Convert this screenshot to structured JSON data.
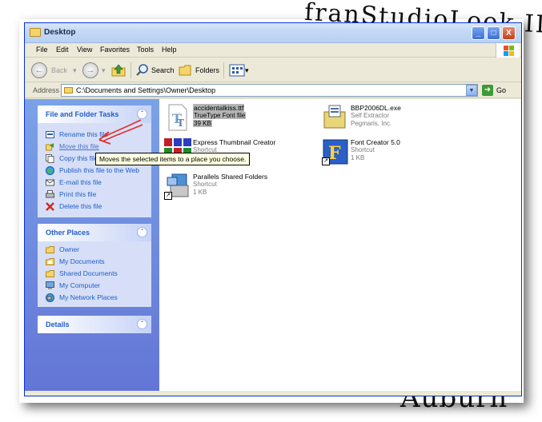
{
  "background": {
    "handwriting_top": "franStudioLook IL",
    "handwriting_bottom": "Auburn"
  },
  "window": {
    "title": "Desktop",
    "buttons": {
      "minimize": "_",
      "maximize": "□",
      "close": "X"
    }
  },
  "menu": {
    "items": [
      "File",
      "Edit",
      "View",
      "Favorites",
      "Tools",
      "Help"
    ]
  },
  "toolbar": {
    "back_label": "Back",
    "search_label": "Search",
    "folders_label": "Folders"
  },
  "address": {
    "label": "Address",
    "value": "C:\\Documents and Settings\\Owner\\Desktop",
    "go_label": "Go"
  },
  "tasks_panel": {
    "title": "File and Folder Tasks",
    "items": [
      {
        "label": "Rename this file",
        "icon": "rename-icon"
      },
      {
        "label": "Move this file",
        "icon": "move-icon"
      },
      {
        "label": "Copy this file",
        "icon": "copy-icon"
      },
      {
        "label": "Publish this file to the Web",
        "icon": "publish-icon"
      },
      {
        "label": "E-mail this file",
        "icon": "email-icon"
      },
      {
        "label": "Print this file",
        "icon": "print-icon"
      },
      {
        "label": "Delete this file",
        "icon": "delete-icon"
      }
    ]
  },
  "places_panel": {
    "title": "Other Places",
    "items": [
      {
        "label": "Owner",
        "icon": "folder-icon"
      },
      {
        "label": "My Documents",
        "icon": "my-documents-icon"
      },
      {
        "label": "Shared Documents",
        "icon": "folder-icon"
      },
      {
        "label": "My Computer",
        "icon": "my-computer-icon"
      },
      {
        "label": "My Network Places",
        "icon": "network-icon"
      }
    ]
  },
  "details_panel": {
    "title": "Details"
  },
  "tooltip": {
    "text": "Moves the selected items to a place you choose."
  },
  "files": [
    {
      "name": "accidentalkiss.ttf",
      "type": "TrueType Font file",
      "size": "39 KB",
      "icon": "font-file-icon",
      "selected": true
    },
    {
      "name": "BBP2006DL.exe",
      "type": "Self Extractor",
      "size": "Pegmaris, Inc.",
      "icon": "installer-icon"
    },
    {
      "name": "Express Thumbnail Creator",
      "type": "Shortcut",
      "size": "",
      "icon": "thumbnail-app-icon"
    },
    {
      "name": "Font Creator 5.0",
      "type": "Shortcut",
      "size": "1 KB",
      "icon": "font-creator-icon"
    },
    {
      "name": "Parallels Shared Folders",
      "type": "Shortcut",
      "size": "1 KB",
      "icon": "shared-folders-icon"
    }
  ],
  "colors": {
    "task_link": "#215dc6",
    "left_pane_top": "#7ba2e7",
    "left_pane_bottom": "#6375d6",
    "arrow": "#e0302f",
    "tooltip_bg": "#ffffe1"
  }
}
